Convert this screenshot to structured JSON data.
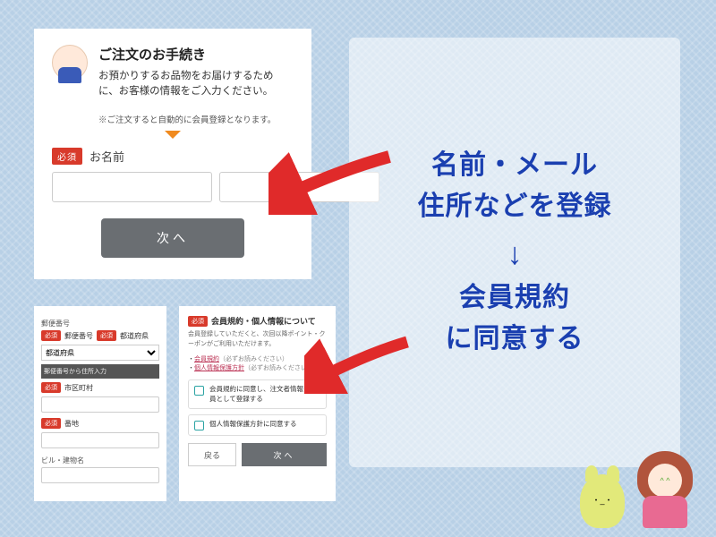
{
  "panel1": {
    "title": "ご注文のお手続き",
    "subtitle": "お預かりするお品物をお届けするために、お客様の情報をご入力ください。",
    "note": "※ご注文すると自動的に会員登録となります。",
    "required_badge": "必須",
    "name_label": "お名前",
    "next_button": "次へ"
  },
  "panel2": {
    "postal_heading": "郵便番号",
    "required_badge": "必須",
    "postal_label": "郵便番号",
    "pref_label": "都道府県",
    "pref_placeholder": "都道府県",
    "addr_lookup": "郵便番号から住所入力",
    "city_label": "市区町村",
    "street_label": "番地",
    "building_label": "ビル・建物名"
  },
  "panel3": {
    "required_badge": "必須",
    "title": "会員規約・個人情報について",
    "desc": "会員登録していただくと、次回以降ポイント・クーポンがご利用いただけます。",
    "link1": "会員規約",
    "link1_note": "（必ずお読みください）",
    "link2": "個人情報保護方針",
    "link2_note": "（必ずお読みください）",
    "chk1": "会員規約に同意し、注文者情報を会員として登録する",
    "chk2": "個人情報保護方針に同意する",
    "back": "戻る",
    "next": "次へ"
  },
  "annot": {
    "line1": "名前・メール",
    "line2": "住所などを登録",
    "arrow": "↓",
    "line3": "会員規約",
    "line4": "に同意する"
  }
}
